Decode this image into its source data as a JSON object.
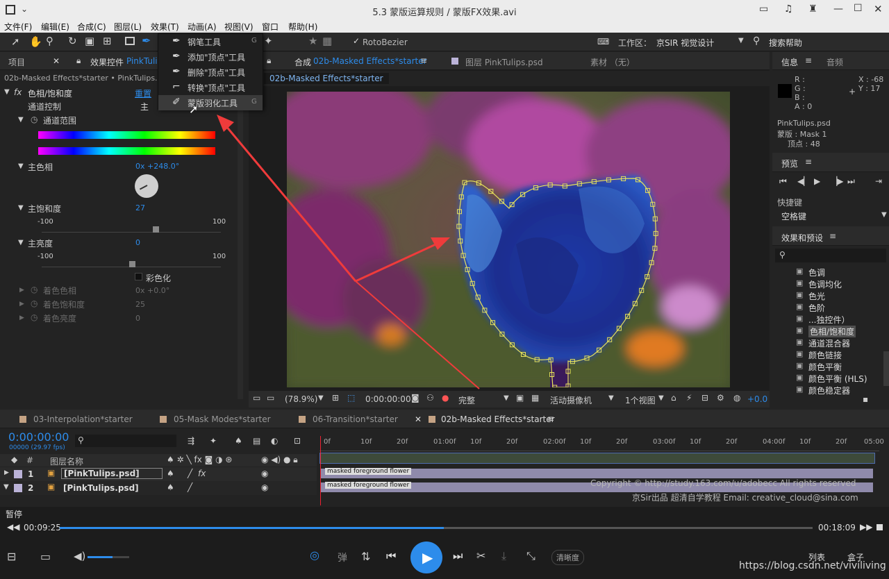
{
  "window": {
    "title": "5.3 蒙版运算规则 / 蒙版FX效果.avi"
  },
  "menu": [
    "文件(F)",
    "编辑(E)",
    "合成(C)",
    "图层(L)",
    "效果(T)",
    "动画(A)",
    "视图(V)",
    "窗口",
    "帮助(H)"
  ],
  "toolbar": {
    "rotobezier": "RotoBezier",
    "workspace_label": "工作区：",
    "workspace_value": "京SIR 视觉设计",
    "search_help": "搜索帮助"
  },
  "pen_menu": [
    {
      "label": "钢笔工具",
      "shortcut": "G"
    },
    {
      "label": "添加\"顶点\"工具",
      "shortcut": ""
    },
    {
      "label": "删除\"顶点\"工具",
      "shortcut": ""
    },
    {
      "label": "转换\"顶点\"工具",
      "shortcut": ""
    },
    {
      "label": "蒙版羽化工具",
      "shortcut": "G"
    }
  ],
  "left_panel": {
    "tab_project": "项目",
    "tab_effects": "效果控件",
    "tab_effects_target": "PinkTulip",
    "breadcrumb": "02b-Masked Effects*starter • PinkTulips.psd",
    "effect_name": "色相/饱和度",
    "reset": "重置",
    "channel_control_label": "通道控制",
    "channel_control_value": "主",
    "channel_range": "通道范围",
    "master_hue_label": "主色相",
    "master_hue_value": "0x +248.0°",
    "master_sat_label": "主饱和度",
    "master_sat_value": "27",
    "master_sat_min": "-100",
    "master_sat_max": "100",
    "master_light_label": "主亮度",
    "master_light_value": "0",
    "master_light_min": "-100",
    "master_light_max": "100",
    "colorize": "彩色化",
    "colorize_hue_label": "着色色相",
    "colorize_hue_value": "0x +0.0°",
    "colorize_sat_label": "着色饱和度",
    "colorize_sat_value": "25",
    "colorize_light_label": "着色亮度",
    "colorize_light_value": "0"
  },
  "comp_panel": {
    "tab_comp": "合成",
    "tab_comp_name": "02b-Masked Effects*starter",
    "tab_layer": "图层 PinkTulips.psd",
    "tab_footage": "素材 （无）",
    "breadcrumb": "02b-Masked Effects*starter",
    "zoom": "(78.9%)",
    "timecode": "0:00:00:00",
    "quality": "完整",
    "camera": "活动摄像机",
    "views": "1个视图",
    "exposure": "+0.0"
  },
  "info_panel": {
    "tab_info": "信息",
    "tab_audio": "音频",
    "r": "R :",
    "g": "G :",
    "b": "B :",
    "a": "A : 0",
    "x": "X : -68",
    "y": "Y : 17",
    "file": "PinkTulips.psd",
    "mask": "蒙版 : Mask 1",
    "vertices": "顶点 : 48"
  },
  "preview_panel": {
    "title": "预览",
    "shortcut_label": "快捷键",
    "shortcut_value": "空格键"
  },
  "effects_presets": {
    "title": "效果和预设",
    "items": [
      "色调",
      "色调均化",
      "色光",
      "色阶",
      "...独控件）",
      "色相/饱和度",
      "通道混合器",
      "颜色链接",
      "颜色平衡",
      "颜色平衡 (HLS)",
      "颜色稳定器"
    ],
    "selected_index": 5
  },
  "timeline": {
    "tabs": [
      "03-Interpolation*starter",
      "05-Mask Modes*starter",
      "06-Transition*starter",
      "02b-Masked Effects*starter"
    ],
    "timecode": "0:00:00:00",
    "fps": "00000 (29.97 fps)",
    "col_num": "#",
    "col_name": "图层名称",
    "ruler": [
      "0f",
      "10f",
      "20f",
      "01:00f",
      "10f",
      "20f",
      "02:00f",
      "10f",
      "20f",
      "03:00f",
      "10f",
      "20f",
      "04:00f",
      "10f",
      "20f",
      "05:00"
    ],
    "layers": [
      {
        "num": "1",
        "name": "[PinkTulips.psd]",
        "bar": "masked foreground flower"
      },
      {
        "num": "2",
        "name": "[PinkTulips.psd]",
        "bar": "masked foreground flower"
      }
    ],
    "copyright": "Copyright © http://study.163.com/u/adobecc All rights reserved",
    "credit": "京Sir出品  超清自学教程  Email: creative_cloud@sina.com"
  },
  "player": {
    "status": "暂停",
    "elapsed": "00:09:25",
    "total": "00:18:09",
    "progress": 0.51,
    "volume": 0.6,
    "bounce": "弹",
    "quality": "清晰度",
    "list": "列表",
    "box": "盒子",
    "watermark": "https://blog.csdn.net/viviliving"
  }
}
